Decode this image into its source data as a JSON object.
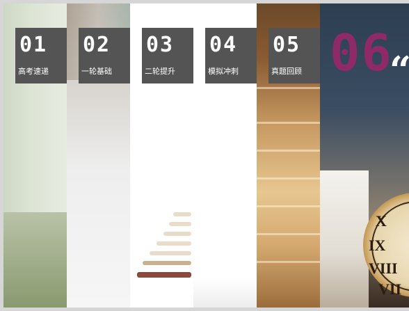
{
  "tiles": [
    {
      "number": "01",
      "label": "高考速递"
    },
    {
      "number": "02",
      "label": "一轮基础"
    },
    {
      "number": "03",
      "label": "二轮提升"
    },
    {
      "number": "04",
      "label": "模拟冲刺"
    },
    {
      "number": "05",
      "label": "真题回顾"
    }
  ],
  "active": {
    "number": "06",
    "quote_glyph": "“"
  },
  "clock": {
    "numerals": [
      "X",
      "IX",
      "VIII",
      "VII"
    ]
  },
  "colors": {
    "tile_bg": "#545454",
    "active_number": "#8e2a67",
    "text": "#ffffff"
  }
}
